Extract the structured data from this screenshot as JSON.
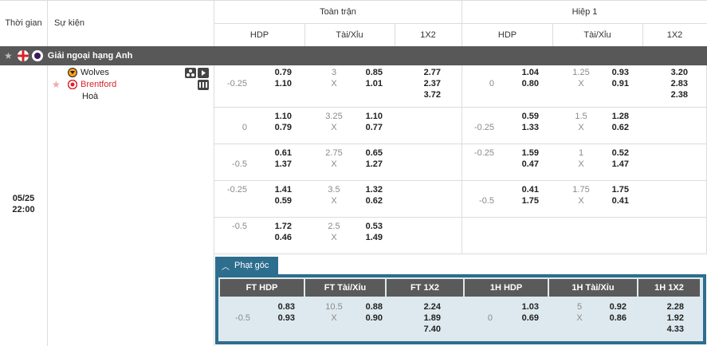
{
  "header": {
    "time_col": "Thời gian",
    "event_col": "Sự kiện",
    "full_match": "Toàn trận",
    "half1": "Hiệp 1",
    "sub": [
      "HDP",
      "Tài/Xỉu",
      "1X2",
      "HDP",
      "Tài/Xỉu",
      "1X2"
    ]
  },
  "league": {
    "name": "Giải ngoại hạng Anh"
  },
  "match": {
    "date": "05/25",
    "time": "22:00",
    "home": "Wolves",
    "away": "Brentford",
    "draw": "Hoà"
  },
  "rows": [
    {
      "ft_hdp_line": "-0.25",
      "ft_hdp_h": "0.79",
      "ft_hdp_a": "1.10",
      "ft_ou_line": "3",
      "ft_ou_x": "X",
      "ft_ou_o": "0.85",
      "ft_ou_u": "1.01",
      "ft_1": "2.77",
      "ft_x": "2.37",
      "ft_2": "3.72",
      "h1_hdp_line": "0",
      "h1_hdp_h": "1.04",
      "h1_hdp_a": "0.80",
      "h1_ou_line": "1.25",
      "h1_ou_x": "X",
      "h1_ou_o": "0.93",
      "h1_ou_u": "0.91",
      "h1_1": "3.20",
      "h1_x": "2.83",
      "h1_2": "2.38"
    },
    {
      "ft_hdp_line": "0",
      "ft_hdp_h": "1.10",
      "ft_hdp_a": "0.79",
      "ft_ou_line": "3.25",
      "ft_ou_x": "X",
      "ft_ou_o": "1.10",
      "ft_ou_u": "0.77",
      "h1_hdp_line": "-0.25",
      "h1_hdp_h": "0.59",
      "h1_hdp_a": "1.33",
      "h1_ou_line": "1.5",
      "h1_ou_x": "X",
      "h1_ou_o": "1.28",
      "h1_ou_u": "0.62"
    },
    {
      "ft_hdp_line": "-0.5",
      "ft_hdp_h": "0.61",
      "ft_hdp_a": "1.37",
      "ft_ou_line": "2.75",
      "ft_ou_x": "X",
      "ft_ou_o": "0.65",
      "ft_ou_u": "1.27",
      "h1_hdp_line": "-0.25",
      "h1_hdp_h": "1.59",
      "h1_hdp_a": "0.47",
      "h1_ou_line": "1",
      "h1_ou_x": "X",
      "h1_ou_o": "0.52",
      "h1_ou_u": "1.47"
    },
    {
      "ft_hdp_line": "-0.25",
      "ft_hdp_h": "1.41",
      "ft_hdp_a": "0.59",
      "ft_ou_line": "3.5",
      "ft_ou_x": "X",
      "ft_ou_o": "1.32",
      "ft_ou_u": "0.62",
      "h1_hdp_line": "-0.5",
      "h1_hdp_h": "0.41",
      "h1_hdp_a": "1.75",
      "h1_ou_line": "1.75",
      "h1_ou_x": "X",
      "h1_ou_o": "1.75",
      "h1_ou_u": "0.41"
    },
    {
      "ft_hdp_line": "-0.5",
      "ft_hdp_h": "1.72",
      "ft_hdp_a": "0.46",
      "ft_ou_line": "2.5",
      "ft_ou_x": "X",
      "ft_ou_o": "0.53",
      "ft_ou_u": "1.49"
    }
  ],
  "corners": {
    "tab": "Phạt góc",
    "headers": [
      "FT HDP",
      "FT Tài/Xỉu",
      "FT 1X2",
      "1H HDP",
      "1H Tài/Xỉu",
      "1H 1X2"
    ],
    "ft_hdp_line": "-0.5",
    "ft_hdp_h": "0.83",
    "ft_hdp_a": "0.93",
    "ft_ou_line": "10.5",
    "ft_ou_x": "X",
    "ft_ou_o": "0.88",
    "ft_ou_u": "0.90",
    "ft_1": "2.24",
    "ft_x": "1.89",
    "ft_2": "7.40",
    "h1_hdp_line": "0",
    "h1_hdp_h": "1.03",
    "h1_hdp_a": "0.69",
    "h1_ou_line": "5",
    "h1_ou_x": "X",
    "h1_ou_o": "0.92",
    "h1_ou_u": "0.86",
    "h1_1": "2.28",
    "h1_x": "1.92",
    "h1_2": "4.33"
  },
  "colors": {
    "league_bar": "#585858",
    "corner_accent": "#2d6e8e",
    "away_team": "#d8232a"
  }
}
